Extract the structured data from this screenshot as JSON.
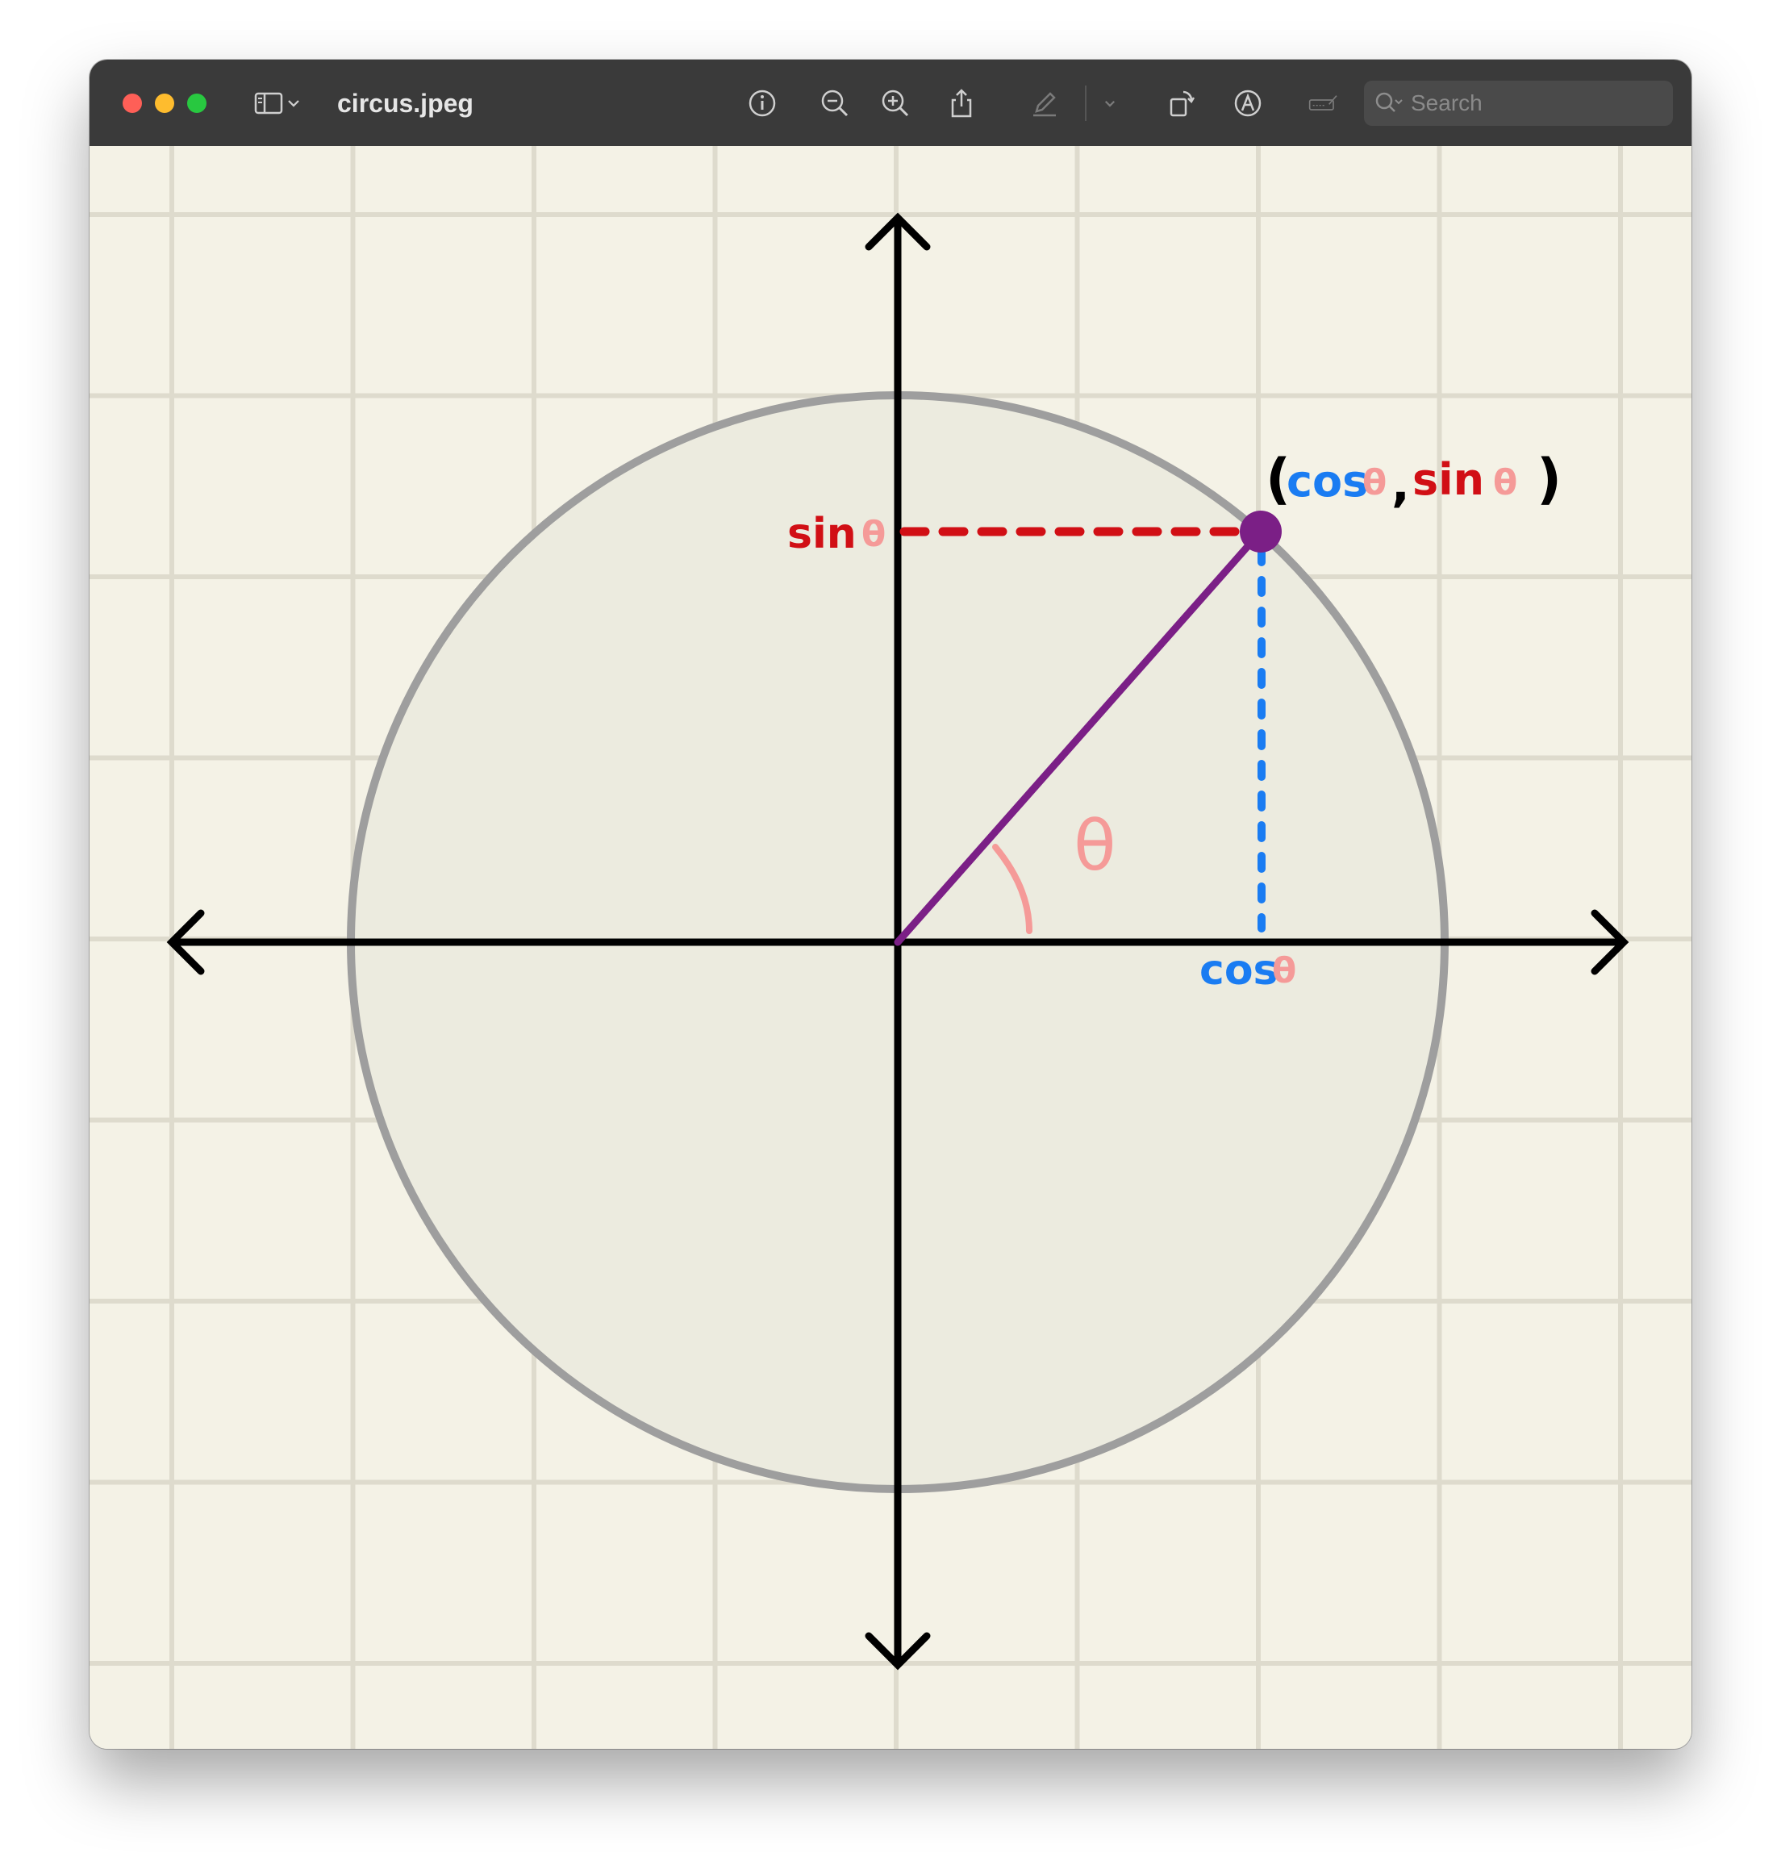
{
  "window": {
    "title": "circus.jpeg",
    "toolbar": {
      "sidebar_icon": "sidebar-icon",
      "info_icon": "info-icon",
      "zoom_out_icon": "zoom-out-icon",
      "zoom_in_icon": "zoom-in-icon",
      "share_icon": "share-icon",
      "markup_icon": "markup-pen-icon",
      "rotate_icon": "rotate-icon",
      "annotate_icon": "annotate-icon",
      "signature_icon": "signature-icon"
    },
    "search": {
      "placeholder": "Search"
    }
  },
  "image": {
    "labels": {
      "point": {
        "open": "(",
        "cos_word": "cos",
        "comma": ",",
        "sin_word": "sin",
        "close": ")"
      },
      "sin_word": "sin",
      "cos_word": "cos",
      "theta": "θ"
    },
    "colors": {
      "paper": "#f4f2e6",
      "grid": "#dedbcd",
      "circle_fill": "#ecebdf",
      "circle_stroke": "#9e9e9e",
      "axes": "#000000",
      "radius": "#7b1f86",
      "sin": "#d10f15",
      "cos": "#1a7cf2",
      "theta": "#f59a98"
    }
  }
}
